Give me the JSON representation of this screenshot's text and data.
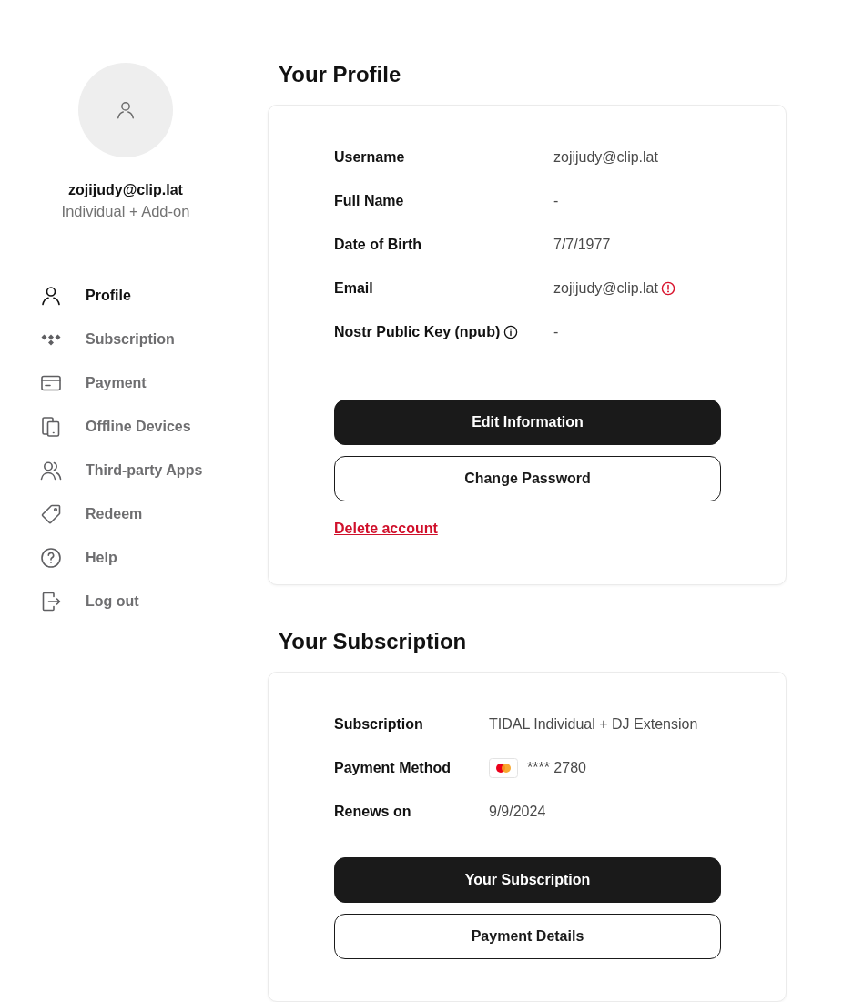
{
  "account": {
    "username": "zojijudy@clip.lat",
    "plan": "Individual + Add-on"
  },
  "nav": [
    {
      "label": "Profile",
      "kind": "person",
      "selected": true
    },
    {
      "label": "Subscription",
      "kind": "diamonds",
      "selected": false
    },
    {
      "label": "Payment",
      "kind": "card",
      "selected": false
    },
    {
      "label": "Offline Devices",
      "kind": "devices",
      "selected": false
    },
    {
      "label": "Third-party Apps",
      "kind": "people",
      "selected": false
    },
    {
      "label": "Redeem",
      "kind": "tag",
      "selected": false
    },
    {
      "label": "Help",
      "kind": "help",
      "selected": false
    },
    {
      "label": "Log out",
      "kind": "logout",
      "selected": false
    }
  ],
  "profile_section": {
    "title": "Your Profile",
    "fields": [
      {
        "label": "Username",
        "value": "zojijudy@clip.lat",
        "info": false,
        "warning": false
      },
      {
        "label": "Full Name",
        "value": "-",
        "info": false,
        "warning": false
      },
      {
        "label": "Date of Birth",
        "value": "7/7/1977",
        "info": false,
        "warning": false
      },
      {
        "label": "Email",
        "value": "zojijudy@clip.lat",
        "info": false,
        "warning": true
      },
      {
        "label": "Nostr Public Key (npub)",
        "value": "-",
        "info": true,
        "warning": false
      }
    ],
    "buttons": [
      {
        "label": "Edit Information",
        "kind": "primary"
      },
      {
        "label": "Change Password",
        "kind": "secondary"
      }
    ],
    "delete_link": "Delete account"
  },
  "subscription_section": {
    "title": "Your Subscription",
    "fields": [
      {
        "label": "Subscription",
        "value": "TIDAL Individual + DJ Extension",
        "kind": "text"
      },
      {
        "label": "Payment Method",
        "value": "**** 2780",
        "kind": "payment"
      },
      {
        "label": "Renews on",
        "value": "9/9/2024",
        "kind": "text"
      }
    ],
    "buttons": [
      {
        "label": "Your Subscription",
        "kind": "primary"
      },
      {
        "label": "Payment Details",
        "kind": "secondary"
      }
    ]
  }
}
